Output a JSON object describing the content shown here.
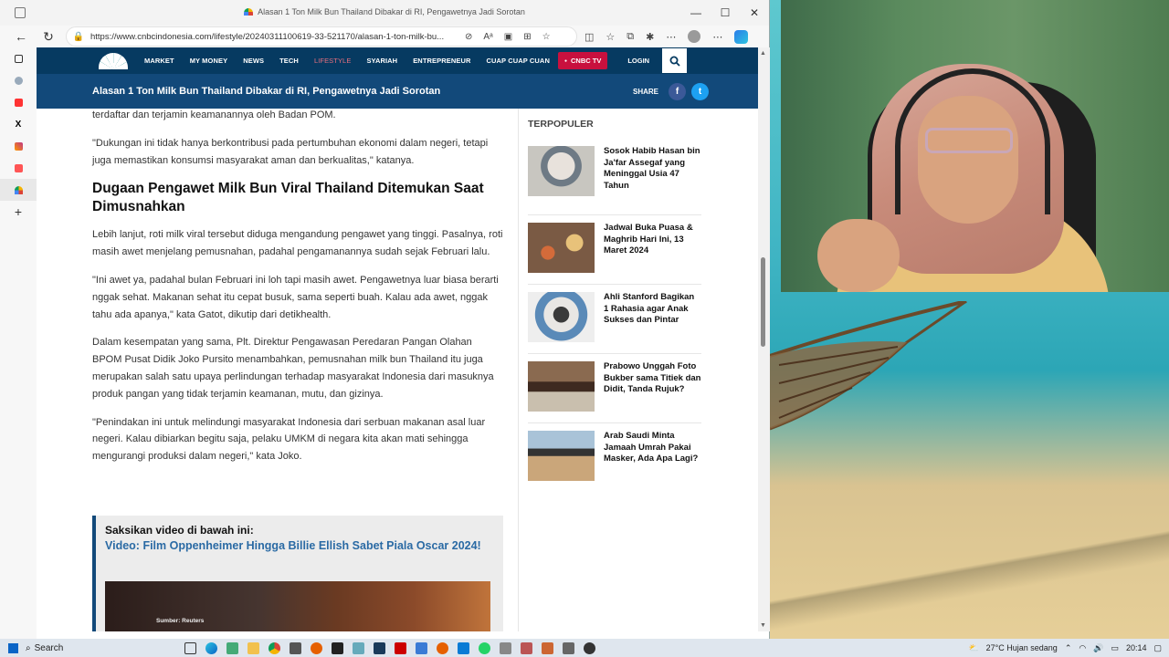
{
  "browser": {
    "tab_title": "Alasan 1 Ton Milk Bun Thailand Dibakar di RI, Pengawetnya Jadi Sorotan",
    "url": "https://www.cnbcindonesia.com/lifestyle/20240311100619-33-521170/alasan-1-ton-milk-bu...",
    "window_controls": [
      "—",
      "☐",
      "✕"
    ]
  },
  "cnbc_nav": {
    "items": [
      "MARKET",
      "MY MONEY",
      "NEWS",
      "TECH",
      "LIFESTYLE",
      "SYARIAH",
      "ENTREPRENEUR",
      "CUAP CUAP CUAN"
    ],
    "active": "LIFESTYLE",
    "tv_label": "CNBC TV",
    "login_label": "LOGIN"
  },
  "article_bar": {
    "title": "Alasan 1 Ton Milk Bun Thailand Dibakar di RI, Pengawetnya Jadi Sorotan",
    "share_label": "SHARE"
  },
  "article": {
    "p0": "terdaftar dan terjamin keamanannya oleh Badan POM.",
    "p1": "\"Dukungan ini tidak hanya berkontribusi pada pertumbuhan ekonomi dalam negeri, tetapi juga memastikan konsumsi masyarakat aman dan berkualitas,\" katanya.",
    "heading": "Dugaan Pengawet Milk Bun Viral Thailand Ditemukan Saat Dimusnahkan",
    "p2": "Lebih lanjut, roti milk viral tersebut diduga mengandung pengawet yang tinggi. Pasalnya, roti masih awet menjelang pemusnahan, padahal pengamanannya sudah sejak Februari lalu.",
    "p3": "\"Ini awet ya, padahal bulan Februari ini loh tapi masih awet. Pengawetnya luar biasa berarti nggak sehat. Makanan sehat itu cepat busuk, sama seperti buah. Kalau ada awet, nggak tahu ada apanya,\" kata Gatot, dikutip dari detikhealth.",
    "p4": "Dalam kesempatan yang sama, Plt. Direktur Pengawasan Peredaran Pangan Olahan BPOM Pusat Didik Joko Pursito menambahkan, pemusnahan milk bun Thailand itu juga merupakan salah satu upaya perlindungan terhadap masyarakat Indonesia dari masuknya produk pangan yang tidak terjamin keamanan, mutu, dan gizinya.",
    "p5": "\"Penindakan ini untuk melindungi masyarakat Indonesia dari serbuan makanan asal luar negeri. Kalau dibiarkan begitu saja, pelaku UMKM di negara kita akan mati sehingga mengurangi produksi dalam negeri,\" kata Joko."
  },
  "video": {
    "label": "Saksikan video di bawah ini:",
    "title": "Video: Film Oppenheimer Hingga Billie Ellish Sabet Piala Oscar 2024!",
    "source": "Sumber: Reuters"
  },
  "trending": {
    "heading": "TERPOPULER",
    "items": [
      {
        "title": "Sosok Habib Hasan bin Ja'far Assegaf yang Meninggal Usia 47 Tahun"
      },
      {
        "title": "Jadwal Buka Puasa & Maghrib Hari Ini, 13 Maret 2024"
      },
      {
        "title": "Ahli Stanford Bagikan 1 Rahasia agar Anak Sukses dan Pintar"
      },
      {
        "title": "Prabowo Unggah Foto Bukber sama Titiek dan Didit, Tanda Rujuk?"
      },
      {
        "title": "Arab Saudi Minta Jamaah Umrah Pakai Masker, Ada Apa Lagi?"
      }
    ]
  },
  "taskbar": {
    "search_label": "Search",
    "weather": "27°C  Hujan sedang",
    "time": "20:14"
  },
  "colors": {
    "nav_bg": "#063a61",
    "article_bar_bg": "#12497a",
    "active_menu": "#e8707f",
    "tv_red": "#c8103e",
    "link_blue": "#2a6aa4"
  }
}
